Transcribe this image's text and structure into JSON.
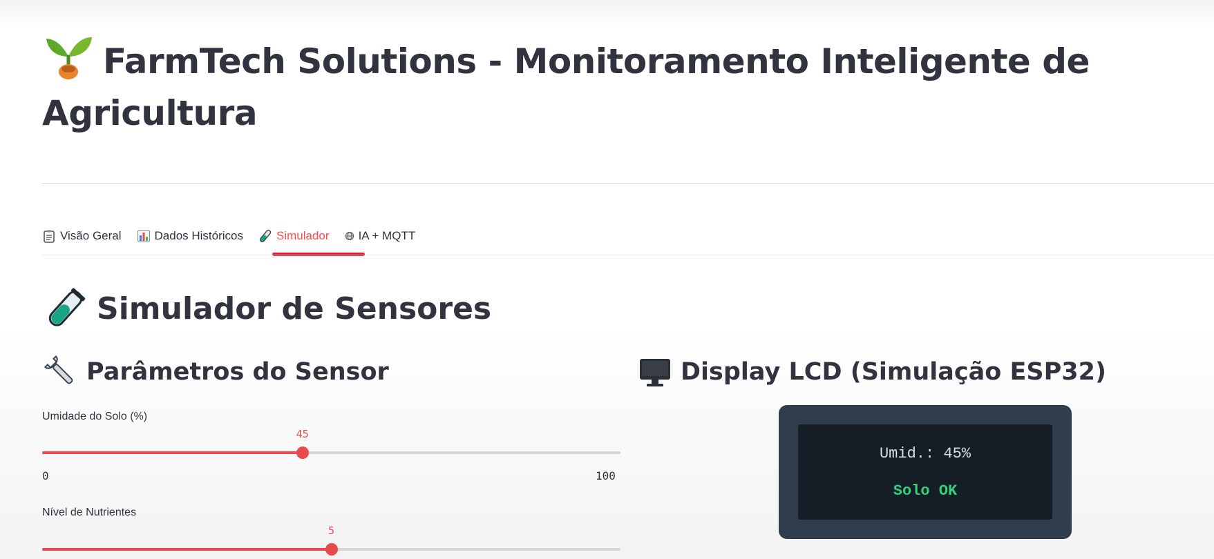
{
  "header": {
    "title_line1": "FarmTech Solutions - Monitoramento Inteligente de",
    "title_line2": "Agricultura",
    "icon": "sprout-icon"
  },
  "tabs": [
    {
      "label": "Visão Geral",
      "icon": "clipboard-icon",
      "active": false
    },
    {
      "label": "Dados Históricos",
      "icon": "bar-chart-icon",
      "active": false
    },
    {
      "label": "Simulador",
      "icon": "test-tube-icon",
      "active": true
    },
    {
      "label": "IA + MQTT",
      "icon": "globe-icon",
      "active": false
    }
  ],
  "section": {
    "title": "Simulador de Sensores",
    "icon": "test-tube-icon"
  },
  "params": {
    "title": "Parâmetros do Sensor",
    "icon": "wrench-icon",
    "sliders": [
      {
        "label": "Umidade do Solo (%)",
        "value": 45,
        "min": 0,
        "max": 100,
        "min_label": "0",
        "max_label": "100",
        "value_label": "45"
      },
      {
        "label": "Nível de Nutrientes",
        "value": 5,
        "min": 0,
        "max": 10,
        "value_label": "5"
      }
    ]
  },
  "lcd": {
    "title": "Display LCD (Simulação ESP32)",
    "icon": "monitor-icon",
    "line1": "Umid.: 45%",
    "line2": "Solo OK"
  },
  "colors": {
    "accent": "#ff4b4b",
    "lcd_frame": "#2f3d4d",
    "lcd_screen": "#151d27",
    "lcd_ok": "#33d17a"
  }
}
